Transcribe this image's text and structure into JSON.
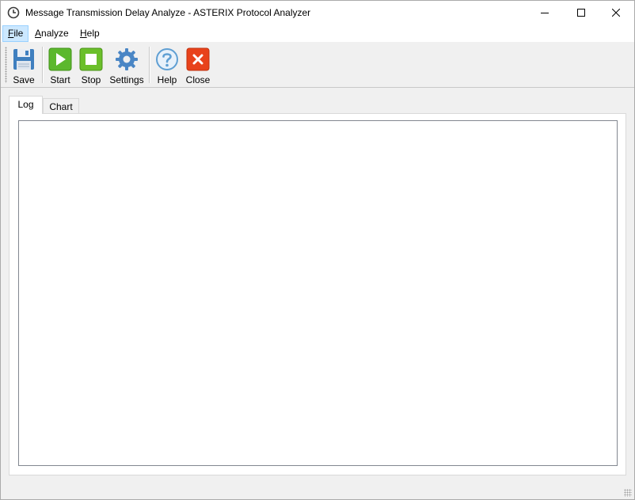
{
  "window": {
    "title": "Message Transmission Delay Analyze - ASTERIX Protocol Analyzer",
    "icon": "clock-icon",
    "controls": {
      "minimize": "minimize-icon",
      "maximize": "maximize-icon",
      "close": "close-icon"
    }
  },
  "menu": {
    "file_key": "F",
    "file_rest": "ile",
    "analyze_key": "A",
    "analyze_rest": "nalyze",
    "help_key": "H",
    "help_rest": "elp"
  },
  "toolbar": {
    "items": [
      {
        "label": "Save",
        "icon": "floppy-disk-icon"
      },
      {
        "label": "Start",
        "icon": "play-icon"
      },
      {
        "label": "Stop",
        "icon": "stop-icon"
      },
      {
        "label": "Settings",
        "icon": "gear-icon"
      },
      {
        "label": "Help",
        "icon": "question-icon"
      },
      {
        "label": "Close",
        "icon": "close-x-icon"
      }
    ]
  },
  "tabs": [
    {
      "label": "Log",
      "selected": true
    },
    {
      "label": "Chart",
      "selected": false
    }
  ],
  "log": {
    "content": ""
  },
  "colors": {
    "start_green": "#5cb82d",
    "stop_green": "#6bbf2a",
    "close_red": "#e8421b",
    "gear_blue": "#4a86c5",
    "help_blue": "#5f9fd3",
    "save_blue": "#3f7fbf",
    "menu_highlight": "#cce8ff"
  }
}
